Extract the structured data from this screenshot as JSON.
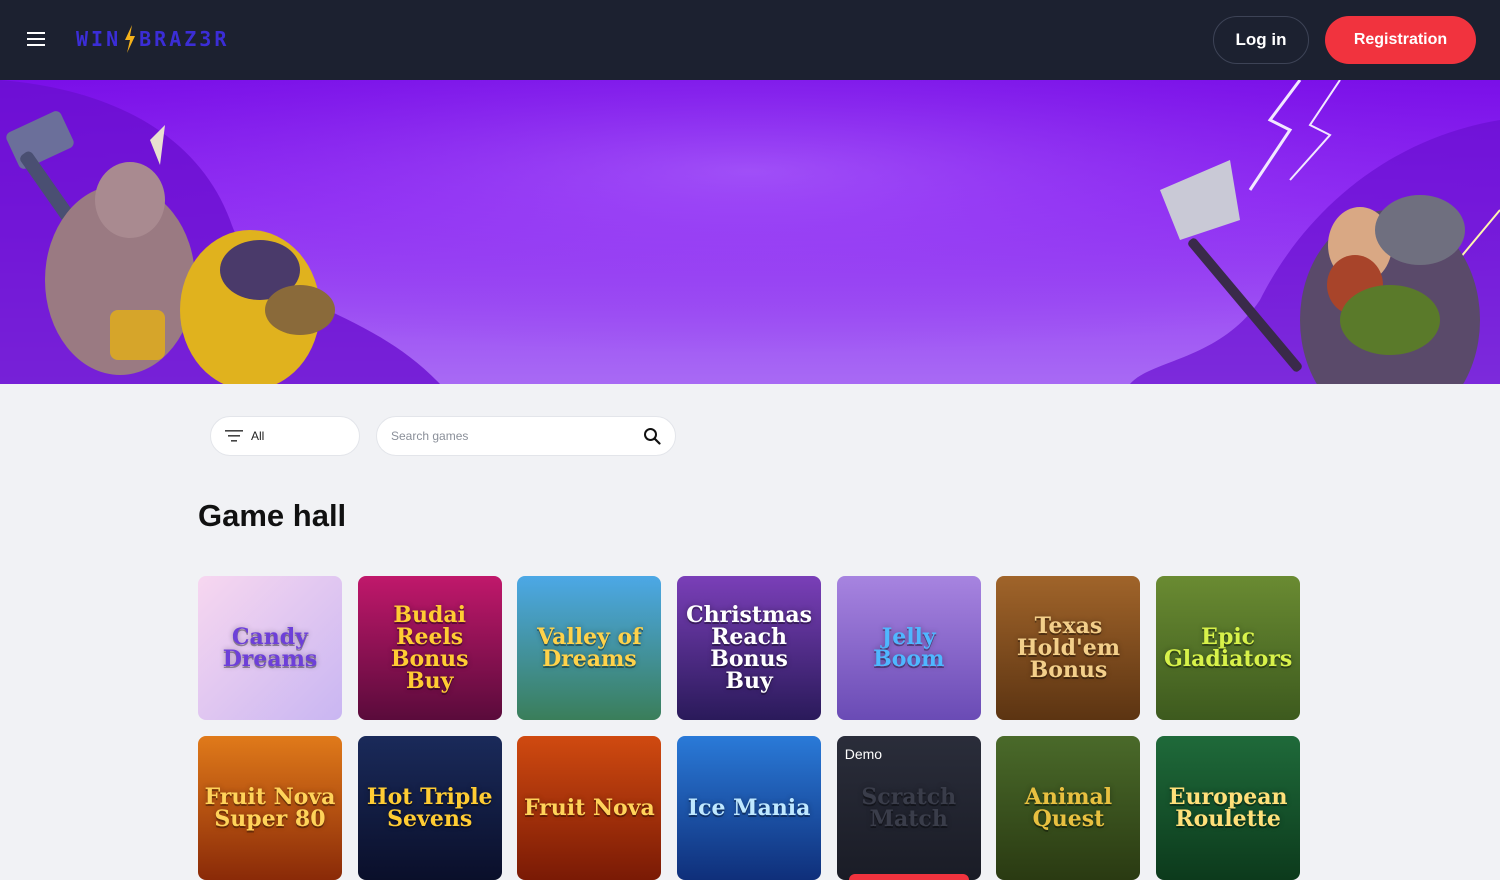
{
  "header": {
    "logo_text_left": "WIN",
    "logo_text_right": "BRAZ3R",
    "login_label": "Log in",
    "register_label": "Registration"
  },
  "filters": {
    "category_label": "All",
    "search_placeholder": "Search games"
  },
  "section_title": "Game hall",
  "games": [
    {
      "name": "Candy Dreams",
      "bg": "linear-gradient(135deg,#f7d7f0,#c9b6f2)",
      "color": "#6d3fd9"
    },
    {
      "name": "Budai Reels Bonus Buy",
      "bg": "linear-gradient(180deg,#c0186b,#5a0b3b)",
      "color": "#ffcc33"
    },
    {
      "name": "Valley of Dreams",
      "bg": "linear-gradient(180deg,#4ca8e6,#3a7e5a)",
      "color": "#ffd24a"
    },
    {
      "name": "Christmas Reach Bonus Buy",
      "bg": "linear-gradient(180deg,#7a3fb8,#2a1a5a)",
      "color": "#ffffff"
    },
    {
      "name": "Jelly Boom",
      "bg": "linear-gradient(180deg,#a784e0,#6a4bb5)",
      "color": "#4fb7ff"
    },
    {
      "name": "Texas Hold'em Bonus",
      "bg": "linear-gradient(180deg,#a0642a,#5c3412)",
      "color": "#f3cf8a"
    },
    {
      "name": "Epic Gladiators",
      "bg": "linear-gradient(180deg,#6a8b32,#3d5a1e)",
      "color": "#d8f24a"
    },
    {
      "name": "Fruit Nova Super 80",
      "bg": "linear-gradient(180deg,#e07a1a,#8a2a08)",
      "color": "#ffd35a"
    },
    {
      "name": "Hot Triple Sevens",
      "bg": "linear-gradient(180deg,#1a2a5a,#0a0f2a)",
      "color": "#ffcc33"
    },
    {
      "name": "Fruit Nova",
      "bg": "linear-gradient(180deg,#d04a10,#7a1a05)",
      "color": "#ffd35a"
    },
    {
      "name": "Ice Mania",
      "bg": "linear-gradient(180deg,#2a7ad8,#0f2f7a)",
      "color": "#bfe8ff"
    },
    {
      "name": "Scratch Match",
      "bg": "linear-gradient(180deg,#2a2d3a,#1a1c26)",
      "color": "#3a3d4a",
      "demo": "Demo"
    },
    {
      "name": "Animal Quest",
      "bg": "linear-gradient(180deg,#4a6a2a,#2a3a12)",
      "color": "#e8c040"
    },
    {
      "name": "European Roulette",
      "bg": "linear-gradient(180deg,#1f6a3a,#0c3a1c)",
      "color": "#ffe07a"
    }
  ]
}
